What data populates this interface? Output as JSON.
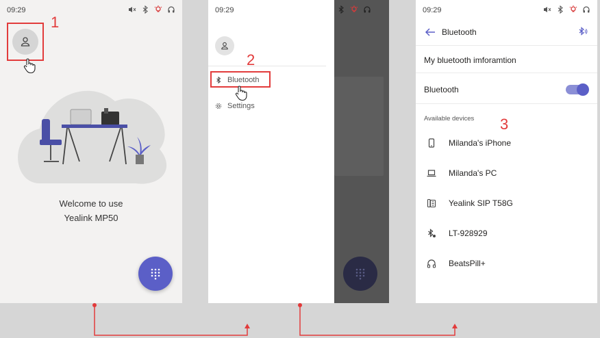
{
  "status": {
    "time": "09:29"
  },
  "panel1": {
    "step_number": "1",
    "welcome_line1": "Welcome to use",
    "welcome_line2": "Yealink MP50"
  },
  "panel2": {
    "step_number": "2",
    "menu": {
      "bluetooth": "Bluetooth",
      "settings": "Settings"
    }
  },
  "panel3": {
    "title": "Bluetooth",
    "my_info": "My bluetooth imforamtion",
    "bluetooth_toggle_label": "Bluetooth",
    "bluetooth_on": true,
    "available_devices_label": "Available devices",
    "step_number": "3",
    "devices": [
      {
        "name": "Milanda's iPhone",
        "icon": "phone-icon"
      },
      {
        "name": "Milanda's PC",
        "icon": "laptop-icon"
      },
      {
        "name": "Yealink SIP T58G",
        "icon": "desk-phone-icon"
      },
      {
        "name": "LT-928929",
        "icon": "bluetooth-device-icon"
      },
      {
        "name": "BeatsPill+",
        "icon": "headphones-icon"
      }
    ]
  },
  "colors": {
    "accent": "#5b5fc7",
    "highlight": "#e23b3b",
    "background": "#d6d6d6"
  }
}
